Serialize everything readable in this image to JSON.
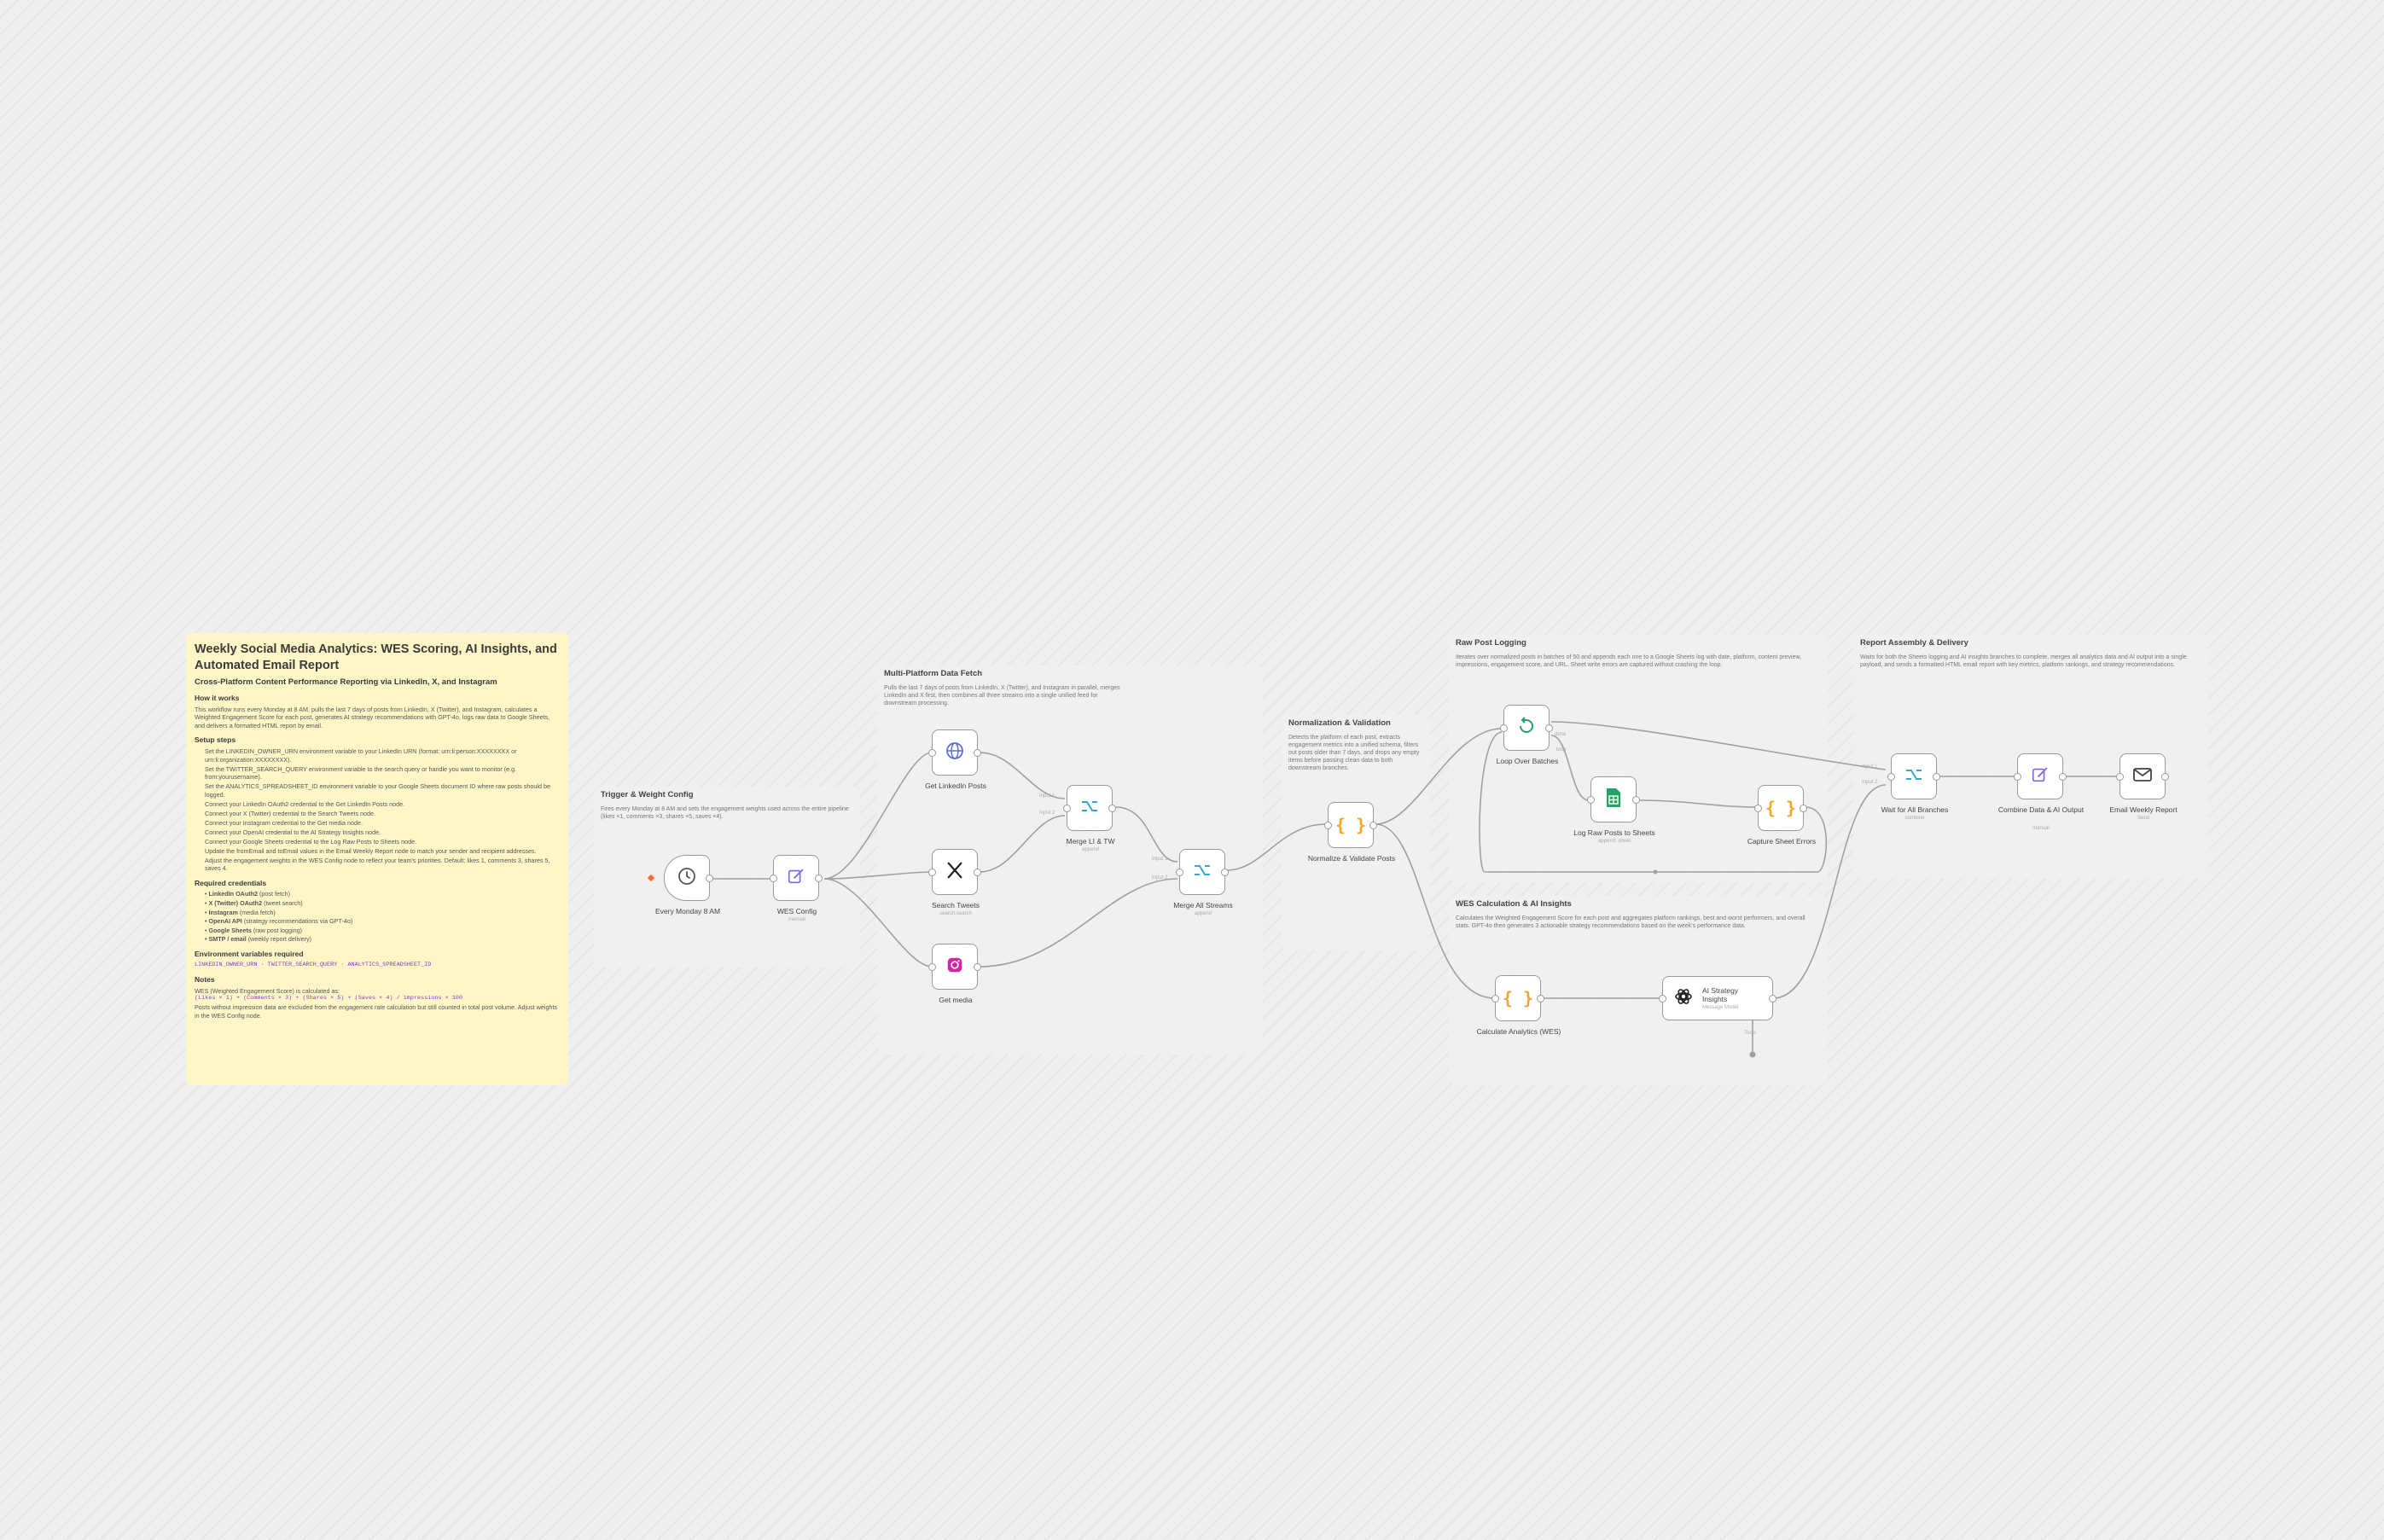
{
  "sticky": {
    "title": "Weekly Social Media Analytics: WES Scoring, AI Insights, and Automated Email Report",
    "subtitle": "Cross-Platform Content Performance Reporting via LinkedIn, X, and Instagram",
    "how_heading": "How it works",
    "how_text": "This workflow runs every Monday at 8 AM, pulls the last 7 days of posts from LinkedIn, X (Twitter), and Instagram, calculates a Weighted Engagement Score for each post, generates AI strategy recommendations with GPT-4o, logs raw data to Google Sheets, and delivers a formatted HTML report by email.",
    "setup_heading": "Setup steps",
    "setup_steps": [
      "Set the LINKEDIN_OWNER_URN environment variable to your LinkedIn URN (format: urn:li:person:XXXXXXXX or urn:li:organization:XXXXXXXX).",
      "Set the TWITTER_SEARCH_QUERY environment variable to the search query or handle you want to monitor (e.g. from:yourusername).",
      "Set the ANALYTICS_SPREADSHEET_ID environment variable to your Google Sheets document ID where raw posts should be logged.",
      "Connect your LinkedIn OAuth2 credential to the Get LinkedIn Posts node.",
      "Connect your X (Twitter) credential to the Search Tweets node.",
      "Connect your Instagram credential to the Get media node.",
      "Connect your OpenAI credential to the AI Strategy Insights node.",
      "Connect your Google Sheets credential to the Log Raw Posts to Sheets node.",
      "Update the fromEmail and toEmail values in the Email Weekly Report node to match your sender and recipient addresses.",
      "Adjust the engagement weights in the WES Config node to reflect your team's priorities. Default: likes 1, comments 3, shares 5, saves 4."
    ],
    "cred_heading": "Required credentials",
    "credentials": [
      {
        "name": "LinkedIn OAuth2",
        "note": " (post fetch)"
      },
      {
        "name": "X (Twitter) OAuth2",
        "note": " (tweet search)"
      },
      {
        "name": "Instagram",
        "note": " (media fetch)"
      },
      {
        "name": "OpenAI API",
        "note": " (strategy recommendations via GPT-4o)"
      },
      {
        "name": "Google Sheets",
        "note": " (raw post logging)"
      },
      {
        "name": "SMTP / email",
        "note": " (weekly report delivery)"
      }
    ],
    "env_heading": "Environment variables required",
    "env_vars": "LINKEDIN_OWNER_URN · TWITTER_SEARCH_QUERY · ANALYTICS_SPREADSHEET_ID",
    "notes_heading": "Notes",
    "notes_intro": "WES (Weighted Engagement Score) is calculated as:",
    "notes_formula": "(Likes × 1) + (Comments × 3) + (Shares × 5) + (Saves × 4) / impressions × 100",
    "notes_text": "Posts without impression data are excluded from the engagement rate calculation but still counted in total post volume. Adjust weights in the WES Config node."
  },
  "groups": {
    "trigger": {
      "title": "Trigger & Weight Config",
      "desc": "Fires every Monday at 8 AM and sets the engagement weights used across the entire pipeline (likes ×1, comments ×3, shares ×5, saves ×4)."
    },
    "fetch": {
      "title": "Multi-Platform Data Fetch",
      "desc": "Pulls the last 7 days of posts from LinkedIn, X (Twitter), and Instagram in parallel, merges LinkedIn and X first, then combines all three streams into a single unified feed for downstream processing."
    },
    "normalize": {
      "title": "Normalization & Validation",
      "desc": "Detects the platform of each post, extracts engagement metrics into a unified schema, filters out posts older than 7 days, and drops any empty items before passing clean data to both downstream branches."
    },
    "rawlog": {
      "title": "Raw Post Logging",
      "desc": "Iterates over normalized posts in batches of 50 and appends each one to a Google Sheets log with date, platform, content preview, impressions, engagement score, and URL. Sheet write errors are captured without crashing the loop."
    },
    "wes": {
      "title": "WES Calculation & AI Insights",
      "desc": "Calculates the Weighted Engagement Score for each post and aggregates platform rankings, best and worst performers, and overall stats. GPT-4o then generates 3 actionable strategy recommendations based on the week's performance data."
    },
    "report": {
      "title": "Report Assembly & Delivery",
      "desc": "Waits for both the Sheets logging and AI insights branches to complete, merges all analytics data and AI output into a single payload, and sends a formatted HTML email report with key metrics, platform rankings, and strategy recommendations."
    }
  },
  "nodes": {
    "monday": {
      "label": "Every Monday 8 AM",
      "sub": ""
    },
    "wesconfig": {
      "label": "WES Config",
      "sub": "manual"
    },
    "linkedin": {
      "label": "Get LinkedIn Posts",
      "sub": ""
    },
    "tweets": {
      "label": "Search Tweets",
      "sub": "search:search"
    },
    "media": {
      "label": "Get media",
      "sub": ""
    },
    "mergelitw": {
      "label": "Merge LI & TW",
      "sub": "append"
    },
    "mergeall": {
      "label": "Merge All Streams",
      "sub": "append"
    },
    "normalize": {
      "label": "Normalize & Validate Posts",
      "sub": ""
    },
    "loop": {
      "label": "Loop Over Batches",
      "sub": ""
    },
    "sheets": {
      "label": "Log Raw Posts to Sheets",
      "sub": "append: sheet"
    },
    "capture": {
      "label": "Capture Sheet Errors",
      "sub": ""
    },
    "calc": {
      "label": "Calculate Analytics (WES)",
      "sub": ""
    },
    "ai": {
      "label": "AI Strategy Insights",
      "sub": "Message Model"
    },
    "wait": {
      "label": "Wait for All Branches",
      "sub": "combine"
    },
    "combine": {
      "label": "Combine Data & AI Output",
      "sub": "manual"
    },
    "email": {
      "label": "Email Weekly Report",
      "sub": "Send"
    }
  },
  "edge_labels": {
    "input1": "Input 1",
    "input2": "Input 2",
    "done": "done",
    "loop": "loop",
    "tools": "Tools"
  },
  "colors": {
    "sticky": "#fff6c8",
    "node_border": "#9a9a9a",
    "edge": "#a0a0a0",
    "trigger_accent": "#ff6d3b",
    "merge_icon": "#36a8c9",
    "code_icon": "#f5a623",
    "sheets_icon": "#22a463",
    "instagram": "#d6249f"
  }
}
